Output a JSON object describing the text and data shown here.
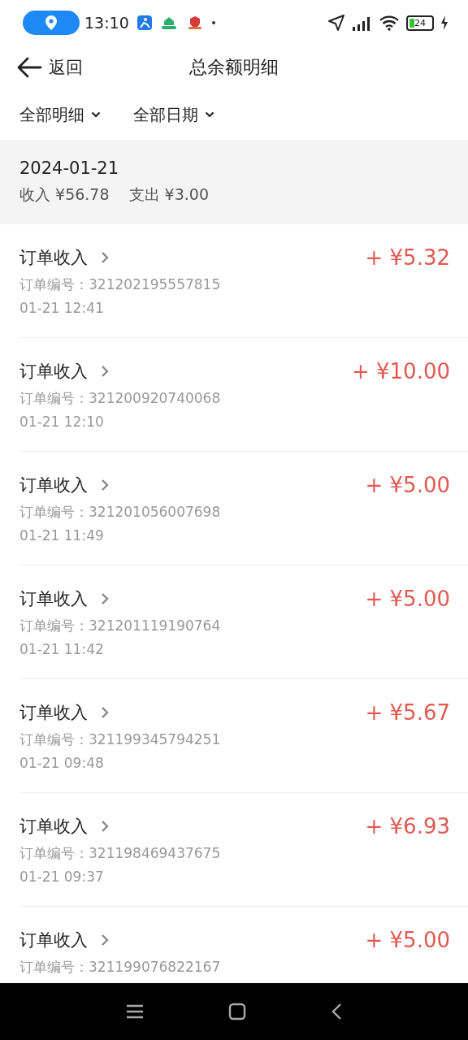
{
  "status_bar": {
    "time": "13:10",
    "battery": "24"
  },
  "header": {
    "back_label": "返回",
    "title": "总余额明细"
  },
  "filters": [
    {
      "label": "全部明细"
    },
    {
      "label": "全部日期"
    }
  ],
  "day_summary": {
    "date": "2024-01-21",
    "income": "收入 ¥56.78",
    "expense": "支出 ¥3.00"
  },
  "transactions": [
    {
      "title": "订单收入",
      "order_no": "订单编号：321202195557815",
      "time": "01-21 12:41",
      "amount": "+ ¥5.32"
    },
    {
      "title": "订单收入",
      "order_no": "订单编号：321200920740068",
      "time": "01-21 12:10",
      "amount": "+ ¥10.00"
    },
    {
      "title": "订单收入",
      "order_no": "订单编号：321201056007698",
      "time": "01-21 11:49",
      "amount": "+ ¥5.00"
    },
    {
      "title": "订单收入",
      "order_no": "订单编号：321201119190764",
      "time": "01-21 11:42",
      "amount": "+ ¥5.00"
    },
    {
      "title": "订单收入",
      "order_no": "订单编号：321199345794251",
      "time": "01-21 09:48",
      "amount": "+ ¥5.67"
    },
    {
      "title": "订单收入",
      "order_no": "订单编号：321198469437675",
      "time": "01-21 09:37",
      "amount": "+ ¥6.93"
    },
    {
      "title": "订单收入",
      "order_no": "订单编号：321199076822167",
      "amount": "+ ¥5.00"
    }
  ]
}
